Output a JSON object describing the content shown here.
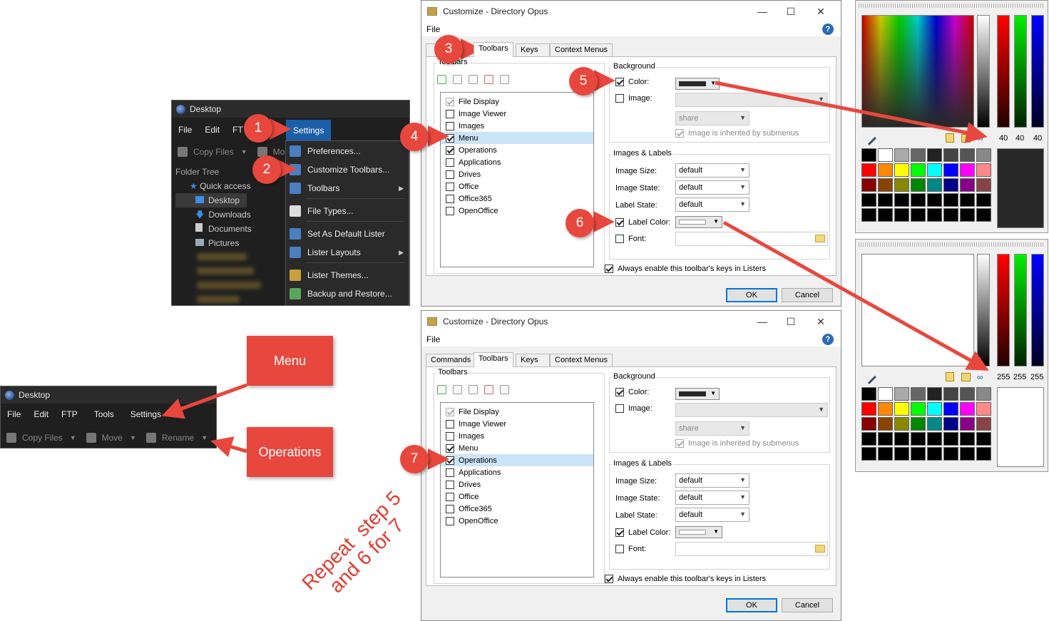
{
  "desktop_window": {
    "title": "Desktop",
    "menu": [
      "File",
      "Edit",
      "FT",
      "Settings"
    ],
    "toolbar": {
      "copy": "Copy Files",
      "move_partial": "Mo"
    },
    "tree_header": "Folder Tree",
    "tree": [
      "Quick access",
      "Desktop",
      "Downloads",
      "Documents",
      "Pictures"
    ]
  },
  "settings_menu": [
    "Preferences...",
    "Customize Toolbars...",
    "Toolbars",
    "File Types...",
    "Set As Default Lister",
    "Lister Layouts",
    "Lister Themes...",
    "Backup and Restore..."
  ],
  "desktop_window2": {
    "title": "Desktop",
    "menu": [
      "File",
      "Edit",
      "FTP",
      "Tools",
      "Settings"
    ],
    "toolbar": [
      "Copy Files",
      "Move",
      "Rename"
    ]
  },
  "labels": {
    "menu_box": "Menu",
    "operations_box": "Operations",
    "repeat_note": "Repeat  step 5\nand 6 for 7"
  },
  "callouts": [
    "1",
    "2",
    "3",
    "4",
    "5",
    "6",
    "7"
  ],
  "dialog": {
    "title": "Customize - Directory Opus",
    "file_menu": "File",
    "help": "?",
    "tabs": [
      "Commands",
      "Toolbars",
      "Keys",
      "Context Menus"
    ],
    "toolbars_group": "Toolbars",
    "toolbar_items": [
      "File Display",
      "Image Viewer",
      "Images",
      "Menu",
      "Operations",
      "Applications",
      "Drives",
      "Office",
      "Office365",
      "OpenOffice"
    ],
    "background_group": "Background",
    "color_label": "Color:",
    "image_label": "Image:",
    "share_value": "share",
    "inherit_label": "Image is inherited by submenus",
    "images_labels_group": "Images & Labels",
    "image_size_label": "Image Size:",
    "image_state_label": "Image State:",
    "label_state_label": "Label State:",
    "default_value": "default",
    "label_color_label": "Label Color:",
    "font_label": "Font:",
    "always_enable": "Always enable this toolbar's keys in Listers",
    "ok": "OK",
    "cancel": "Cancel"
  },
  "picker1": {
    "r": "40",
    "g": "40",
    "b": "40"
  },
  "picker2": {
    "r": "255",
    "g": "255",
    "b": "255"
  },
  "colors": {
    "accent": "#e8473e",
    "selection": "#cce4f7"
  }
}
